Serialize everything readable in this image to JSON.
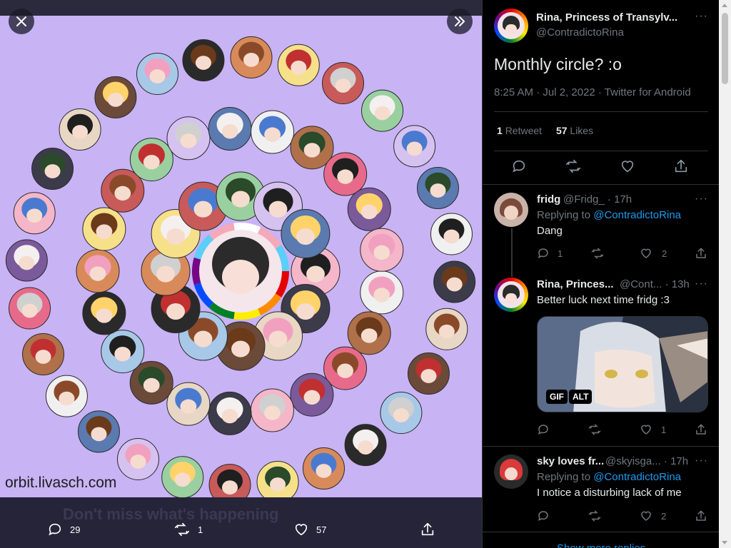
{
  "viewer": {
    "watermark": "orbit.livasch.com",
    "background_text": "Don't miss what's happening",
    "close_icon": "close-icon",
    "collapse_icon": "double-chevron-right-icon",
    "actions": {
      "reply_count": "29",
      "retweet_count": "1",
      "like_count": "57"
    },
    "colors": {
      "image_bg": "#c8b3f5",
      "viewer_bg": "#252438"
    }
  },
  "tweet": {
    "author_name": "Rina, Princess of Transylv...",
    "author_handle": "@ContradictoRina",
    "text": "Monthly circle? :o",
    "meta": "8:25 AM · Jul 2, 2022 · Twitter for Android",
    "retweets": "1",
    "retweets_label": "Retweet",
    "likes": "57",
    "likes_label": "Likes"
  },
  "replies": [
    {
      "name": "fridg",
      "handle_time": "@Fridg_ · 17h",
      "replying_prefix": "Replying to ",
      "replying_to": "@ContradictoRina",
      "text": "Dang",
      "reply_count": "1",
      "retweet_count": "",
      "like_count": "2"
    },
    {
      "name": "Rina, Princes...",
      "handle_time": "@Cont... · 13h",
      "text": "Better luck next time fridg :3",
      "gif_label": "GIF",
      "alt_label": "ALT",
      "reply_count": "",
      "retweet_count": "",
      "like_count": "1"
    },
    {
      "name": "sky loves fr...",
      "handle_time": "@skyisga... · 17h",
      "replying_prefix": "Replying to ",
      "replying_to": "@ContradictoRina",
      "text": "I notice a disturbing lack of me",
      "reply_count": "",
      "retweet_count": "",
      "like_count": "2"
    }
  ],
  "show_more": "Show more replies",
  "accent": "#1d9bf0"
}
